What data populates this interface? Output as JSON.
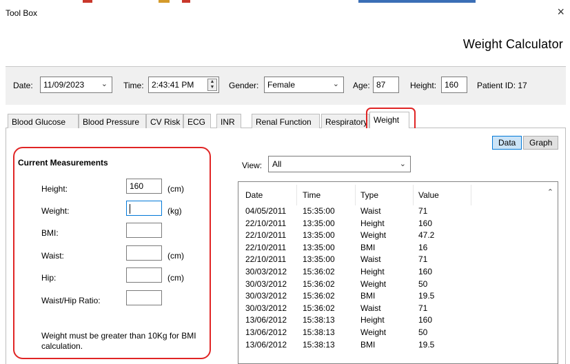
{
  "window": {
    "title": "Tool Box",
    "close_icon": "×"
  },
  "header": {
    "calculator_title": "Weight Calculator"
  },
  "patient": {
    "date_label": "Date:",
    "date_value": "11/09/2023",
    "time_label": "Time:",
    "time_value": "2:43:41 PM",
    "gender_label": "Gender:",
    "gender_value": "Female",
    "age_label": "Age:",
    "age_value": "87",
    "height_label": "Height:",
    "height_value": "160",
    "patient_id": "Patient ID: 17"
  },
  "tabs": [
    {
      "label": "Blood Glucose"
    },
    {
      "label": "Blood Pressure"
    },
    {
      "label": "CV Risk"
    },
    {
      "label": "ECG"
    },
    {
      "label": "INR"
    },
    {
      "label": "Renal Function"
    },
    {
      "label": "Respiratory"
    },
    {
      "label": "Weight"
    }
  ],
  "active_tab": "Weight",
  "view_toggle": {
    "data_label": "Data",
    "graph_label": "Graph",
    "selected": "Data"
  },
  "measurements": {
    "title": "Current Measurements",
    "height_label": "Height:",
    "height_value": "160",
    "height_unit": "(cm)",
    "weight_label": "Weight:",
    "weight_value": "",
    "weight_unit": "(kg)",
    "bmi_label": "BMI:",
    "bmi_value": "",
    "waist_label": "Waist:",
    "waist_value": "",
    "waist_unit": "(cm)",
    "hip_label": "Hip:",
    "hip_value": "",
    "hip_unit": "(cm)",
    "ratio_label": "Waist/Hip Ratio:",
    "ratio_value": "",
    "note": "Weight must be greater than 10Kg for BMI calculation."
  },
  "view_filter": {
    "label": "View:",
    "value": "All"
  },
  "history": {
    "columns": [
      "Date",
      "Time",
      "Type",
      "Value"
    ],
    "rows": [
      [
        "04/05/2011",
        "15:35:00",
        "Waist",
        "71"
      ],
      [
        "22/10/2011",
        "13:35:00",
        "Height",
        "160"
      ],
      [
        "22/10/2011",
        "13:35:00",
        "Weight",
        "47.2"
      ],
      [
        "22/10/2011",
        "13:35:00",
        "BMI",
        "16"
      ],
      [
        "22/10/2011",
        "13:35:00",
        "Waist",
        "71"
      ],
      [
        "30/03/2012",
        "15:36:02",
        "Height",
        "160"
      ],
      [
        "30/03/2012",
        "15:36:02",
        "Weight",
        "50"
      ],
      [
        "30/03/2012",
        "15:36:02",
        "BMI",
        "19.5"
      ],
      [
        "30/03/2012",
        "15:36:02",
        "Waist",
        "71"
      ],
      [
        "13/06/2012",
        "15:38:13",
        "Height",
        "160"
      ],
      [
        "13/06/2012",
        "15:38:13",
        "Weight",
        "50"
      ],
      [
        "13/06/2012",
        "15:38:13",
        "BMI",
        "19.5"
      ]
    ]
  },
  "colors": {
    "highlight": "#e02424",
    "panel_bg": "#f0f0f0",
    "selected_button": "#cce4f7"
  }
}
